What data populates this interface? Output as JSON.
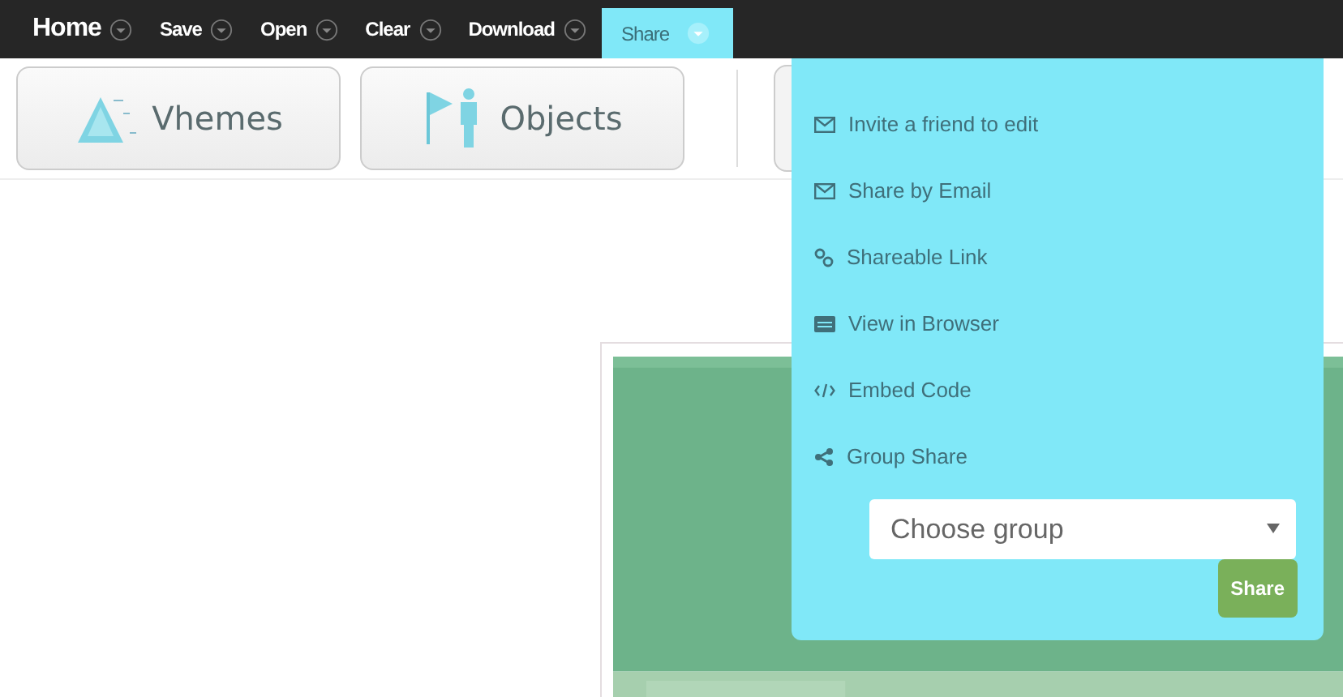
{
  "menu": [
    {
      "label": "Home",
      "selected": false
    },
    {
      "label": "Save",
      "selected": false
    },
    {
      "label": "Open",
      "selected": false
    },
    {
      "label": "Clear",
      "selected": false
    },
    {
      "label": "Download",
      "selected": false
    },
    {
      "label": "Share",
      "selected": true
    }
  ],
  "toolbar": [
    {
      "label": "Vhemes",
      "kind": "themes"
    },
    {
      "label": "Objects",
      "kind": "objects"
    }
  ],
  "share_menu": {
    "items": [
      {
        "label": "Invite a friend to edit",
        "kind": "mail"
      },
      {
        "label": "Share by Email",
        "kind": "mail"
      },
      {
        "label": "Shareable Link",
        "kind": "link"
      },
      {
        "label": "View in Browser",
        "kind": "browser"
      },
      {
        "label": "Embed Code",
        "kind": "code"
      },
      {
        "label": "Group Share",
        "kind": "share"
      }
    ],
    "group_select": {
      "placeholder": "Choose group"
    },
    "button": "Share"
  }
}
